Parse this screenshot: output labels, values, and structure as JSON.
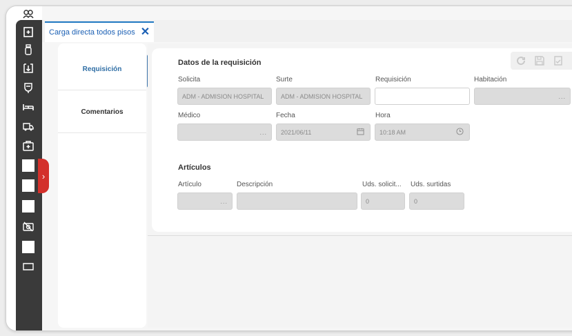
{
  "tab": {
    "label": "Carga directa todos pisos",
    "close": "✕"
  },
  "nav": [
    {
      "label": "Requisición"
    },
    {
      "label": "Comentarios"
    }
  ],
  "datos": {
    "title": "Datos de la requisición",
    "solicita": {
      "label": "Solicita",
      "value": "ADM - ADMISION HOSPITAL"
    },
    "surte": {
      "label": "Surte",
      "value": "ADM - ADMISION HOSPITAL"
    },
    "requisicion": {
      "label": "Requisición",
      "value": ""
    },
    "habitacion": {
      "label": "Habitación",
      "value": "..."
    },
    "medico": {
      "label": "Médico",
      "value": "..."
    },
    "fecha": {
      "label": "Fecha",
      "value": "2021/06/11"
    },
    "hora": {
      "label": "Hora",
      "value": "10:18 AM"
    }
  },
  "articulos": {
    "title": "Artículos",
    "articulo": {
      "label": "Artículo",
      "value": "..."
    },
    "descripcion": {
      "label": "Descripción",
      "value": ""
    },
    "uds_solicitadas": {
      "label": "Uds. solicit...",
      "value": "0"
    },
    "uds_surtidas": {
      "label": "Uds. surtidas",
      "value": "0"
    }
  },
  "colors": {
    "accent": "#1a5fb4",
    "rail": "#3a3a3a",
    "expand": "#d3302b"
  }
}
